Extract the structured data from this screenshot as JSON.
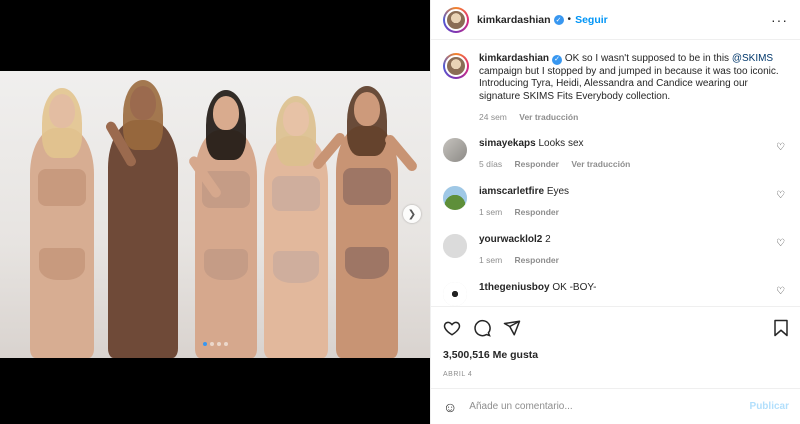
{
  "header": {
    "username": "kimkardashian",
    "separator": "•",
    "follow_label": "Seguir",
    "more_icon": "more-horizontal-icon",
    "verified_icon": "verified-badge-icon"
  },
  "caption": {
    "username": "kimkardashian",
    "text_before": " OK so I wasn't supposed to be in this ",
    "mention": "@SKIMS",
    "text_after": " campaign but I stopped by and jumped in because it was too iconic. Introducing Tyra, Heidi, Alessandra and Candice wearing our signature SKIMS Fits Everybody collection.",
    "time": "24 sem",
    "translate_label": "Ver traducción"
  },
  "comments": [
    {
      "username": "simayekaps",
      "text": "Looks sex",
      "time": "5 días",
      "reply_label": "Responder",
      "translate_label": "Ver traducción"
    },
    {
      "username": "iamscarletfire",
      "text": "Eyes",
      "time": "1 sem",
      "reply_label": "Responder"
    },
    {
      "username": "yourwacklol2",
      "text": "2",
      "time": "1 sem",
      "reply_label": "Responder"
    },
    {
      "username": "1thegeniusboy",
      "text": "OK -BOY-"
    }
  ],
  "actions": {
    "likes": "3,500,516 Me gusta",
    "date": "ABRIL 4",
    "icons": [
      "heart-icon",
      "comment-icon",
      "share-icon",
      "bookmark-icon"
    ]
  },
  "add_comment": {
    "placeholder": "Añade un comentario...",
    "publish_label": "Publicar",
    "emoji_icon": "emoji-icon"
  },
  "carousel": {
    "total_slides": 4,
    "active_slide": 1,
    "next_icon": "chevron-right-icon"
  },
  "colors": {
    "link_blue": "#0095f6",
    "publish_disabled": "#b2dffc",
    "muted": "#8e8e8e"
  }
}
